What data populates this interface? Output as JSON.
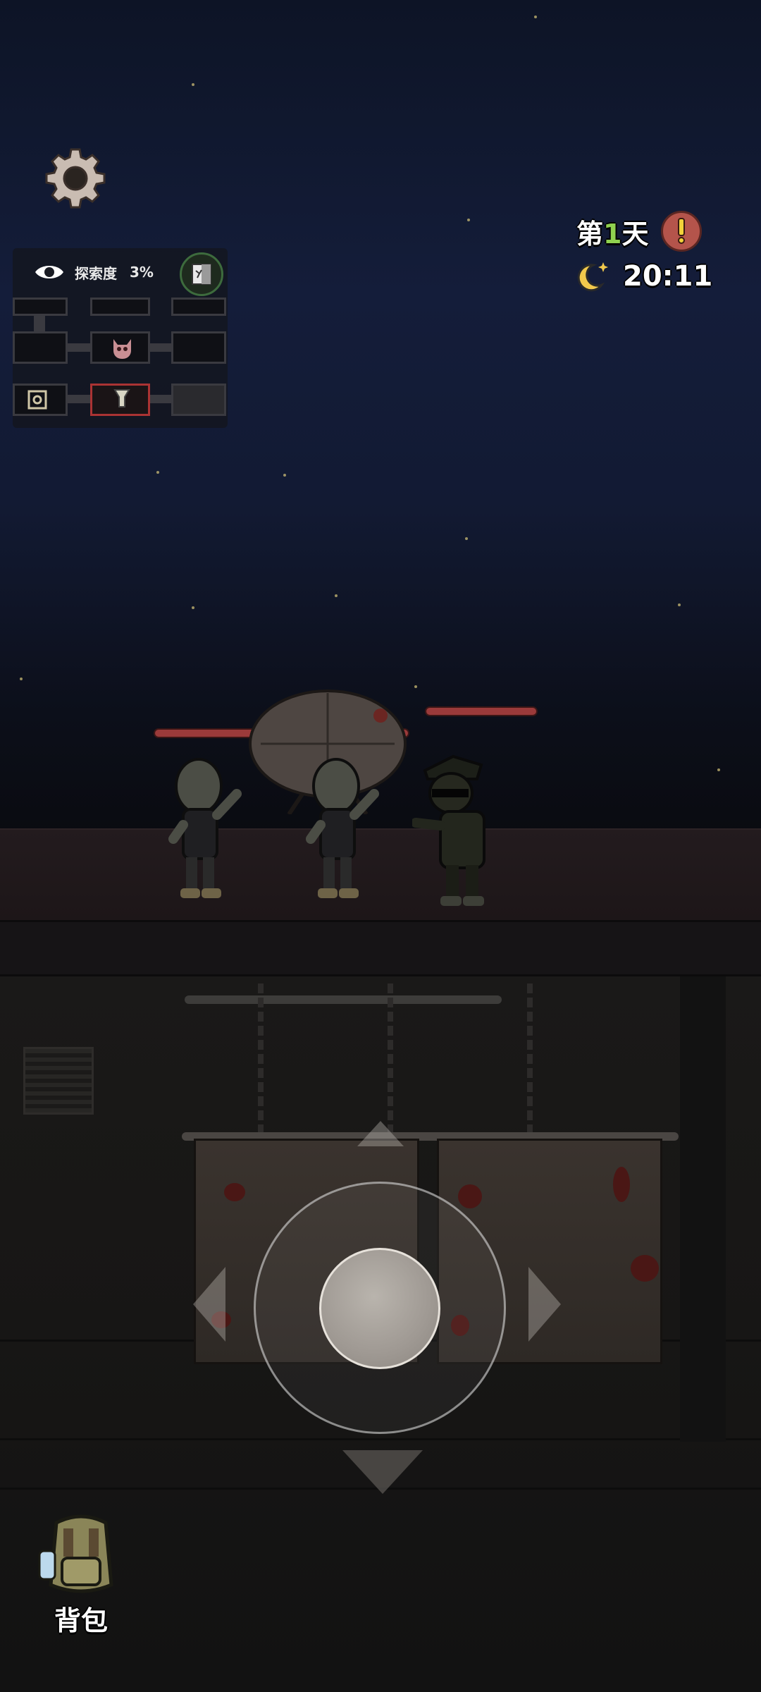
{
  "hud": {
    "settings_icon": "gear-icon",
    "exploration": {
      "label": "探索度",
      "value": "3%",
      "icon": "eye-icon"
    },
    "exit_icon": "exit-door-icon",
    "day": {
      "prefix": "第",
      "number": "1",
      "suffix": "天",
      "alert_icon": "exclamation-icon"
    },
    "time": {
      "value": "20:11",
      "icon": "moon-night-icon"
    }
  },
  "minimap": {
    "rooms": [
      "room",
      "boss-room",
      "room",
      "safe-room",
      "current-room",
      "room"
    ]
  },
  "scene": {
    "enemies": [
      {
        "type": "zombie",
        "health_fraction": 1.0
      },
      {
        "type": "zombie",
        "health_fraction": 1.0
      },
      {
        "type": "soldier",
        "health_fraction": 1.0
      }
    ]
  },
  "controls": {
    "joystick_icon": "joystick-icon",
    "arrows": [
      "up-arrow-icon",
      "down-arrow-icon",
      "left-arrow-icon",
      "right-arrow-icon"
    ]
  },
  "inventory": {
    "label": "背包",
    "icon": "backpack-icon"
  },
  "colors": {
    "day_number": "#8fd14f",
    "alert": "#b4544b",
    "hp_bar": "#9a3a3a"
  }
}
